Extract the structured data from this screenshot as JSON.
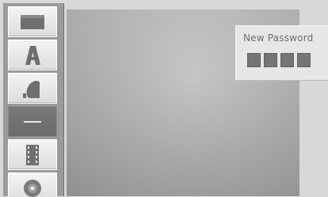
{
  "menu": {
    "items": [
      {
        "id": "disc",
        "icon": "disc-tray-icon",
        "selected": false
      },
      {
        "id": "language",
        "icon": "letter-a-icon",
        "selected": false
      },
      {
        "id": "audio",
        "icon": "audio-shapes-icon",
        "selected": false
      },
      {
        "id": "lock",
        "icon": "dash-icon",
        "selected": true
      },
      {
        "id": "video",
        "icon": "film-strip-icon",
        "selected": false
      },
      {
        "id": "others",
        "icon": "disc-icon",
        "selected": false
      }
    ]
  },
  "password_panel": {
    "title": "New Password",
    "digits_entered": 0,
    "digit_slots": 4
  },
  "colors": {
    "selected_tile": "#6e6e6e",
    "slot": "#757575",
    "panel": "#e7e7e7"
  }
}
